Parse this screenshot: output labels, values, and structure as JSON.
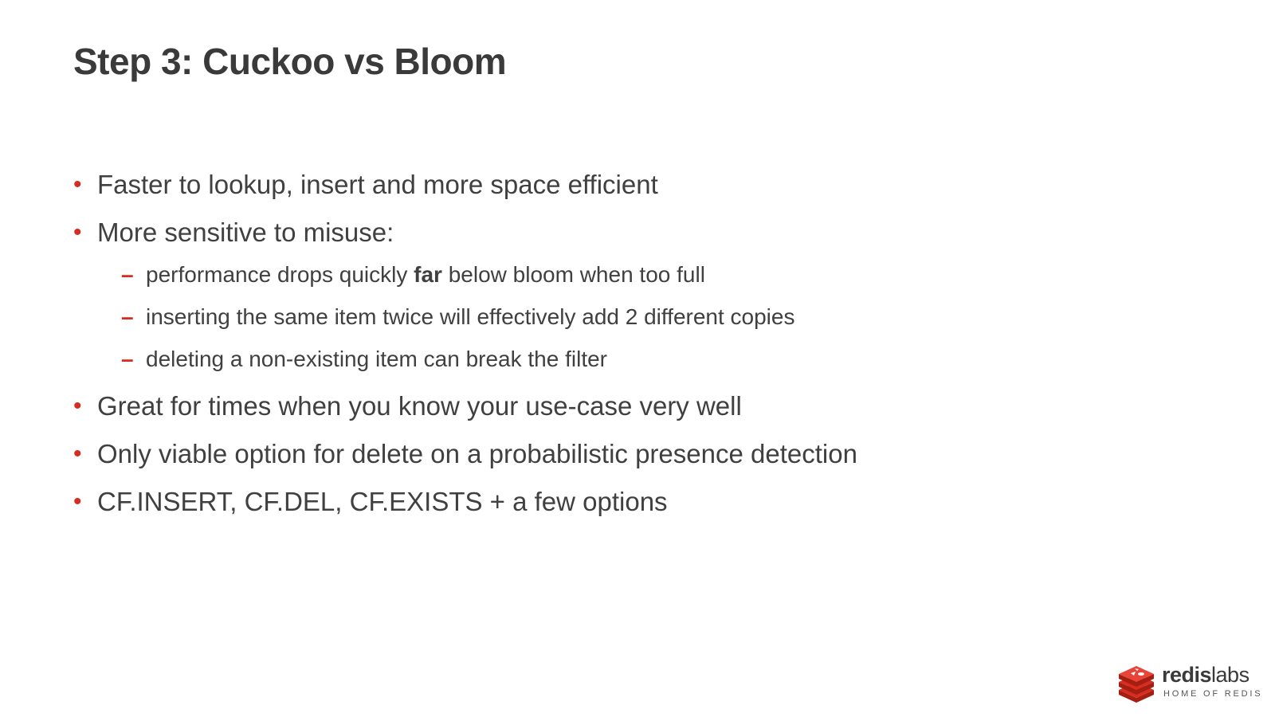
{
  "slide": {
    "title": "Step 3: Cuckoo vs Bloom",
    "bullet_marker": "•",
    "sub_marker": "–",
    "bullets": [
      {
        "text": "Faster to lookup, insert and more space efficient"
      },
      {
        "text": "More sensitive to misuse:",
        "sub_items": [
          {
            "before": "performance drops quickly ",
            "bold": "far",
            "after": " below bloom when too full"
          },
          {
            "text": "inserting the same item twice will effectively add 2 different copies"
          },
          {
            "text": "deleting a non-existing item can break the filter"
          }
        ]
      },
      {
        "text": "Great for times when you know your use-case very well"
      },
      {
        "text": "Only viable option for delete on a probabilistic presence detection"
      },
      {
        "text": "CF.INSERT, CF.DEL, CF.EXISTS + a few options"
      }
    ]
  },
  "logo": {
    "name_bold": "redis",
    "name_light": "labs",
    "tagline": "HOME OF REDIS",
    "icon": "redis-cube-stack-icon"
  },
  "colors": {
    "accent": "#d82c20",
    "text": "#404040",
    "title": "#3a3a3a",
    "background": "#ffffff"
  }
}
